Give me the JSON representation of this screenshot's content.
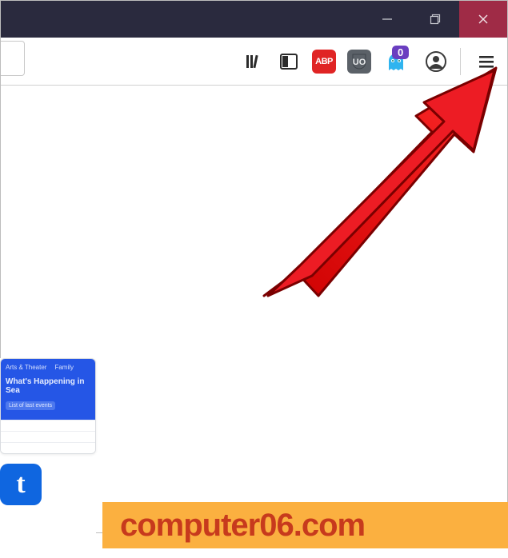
{
  "toolbar": {
    "library_icon": "library-icon",
    "sidebar_icon": "sidebar-icon",
    "abp_label": "ABP",
    "ublock_icon": "ublock-icon",
    "ghostery_icon": "ghostery-icon",
    "ghostery_badge": "0",
    "account_icon": "account-icon",
    "menu_icon": "menu-icon"
  },
  "window_controls": {
    "minimize": "minimize",
    "maximize": "maximize-restore",
    "close": "close"
  },
  "thumbnail": {
    "tabs": [
      "Arts & Theater",
      "Family"
    ],
    "hero_line": "What's Happening in Sea",
    "pills": [
      "List of last events",
      ""
    ],
    "logo_letter": "t"
  },
  "watermark": {
    "text": "computer06.com"
  },
  "annotation": {
    "arrow_points_to": "menu-button"
  },
  "colors": {
    "titlebar": "#2a2a3e",
    "close": "#9f2b46",
    "abp": "#e02424",
    "ublock": "#5b6168",
    "ghostery_badge": "#6a3ec0",
    "thumb_blue": "#2556e6",
    "t_logo": "#0f66e0",
    "watermark_bg": "#fbb040",
    "watermark_fg": "#c73a1d",
    "arrow": "#ed1c24"
  }
}
